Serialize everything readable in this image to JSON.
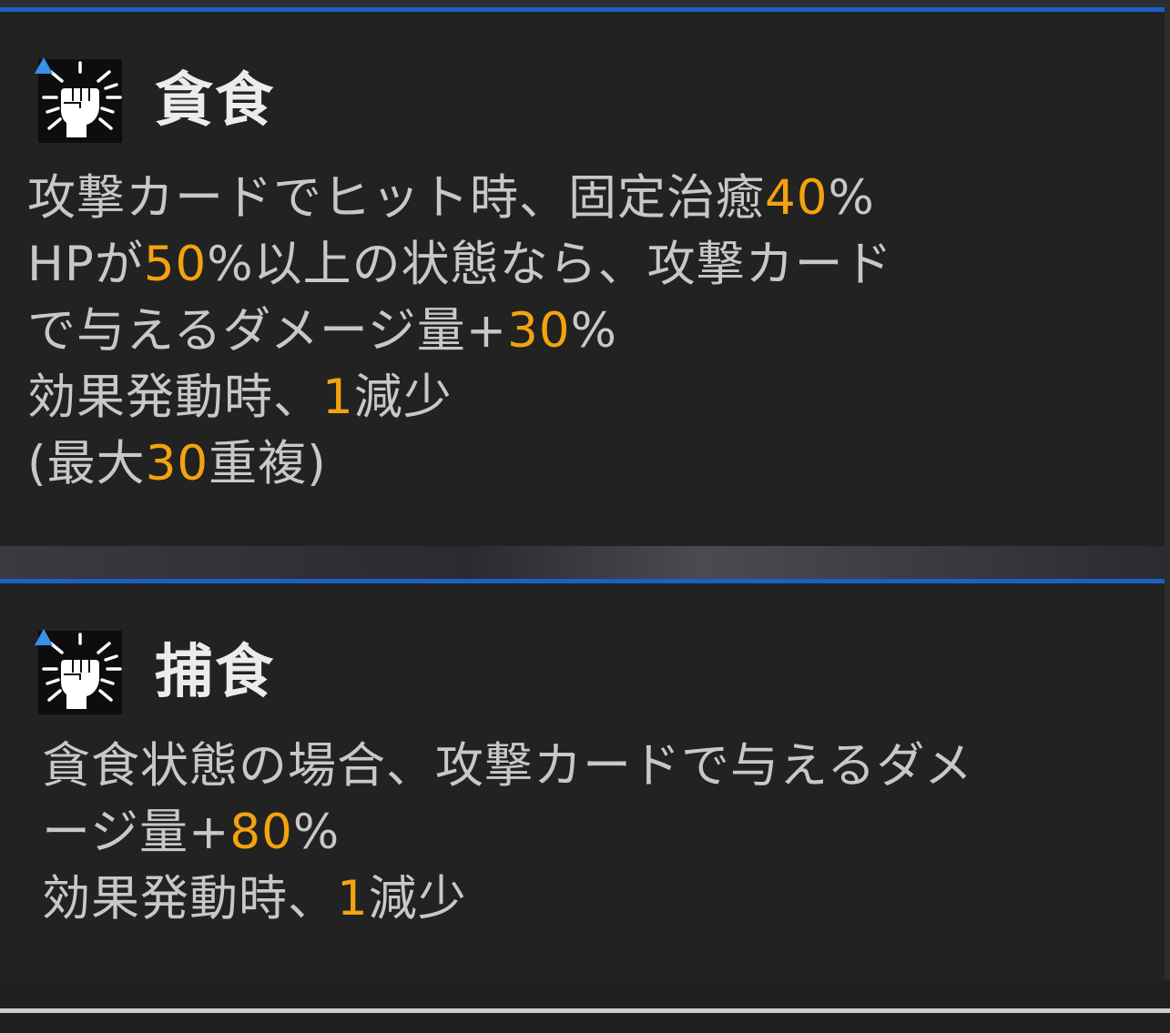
{
  "colors": {
    "accent_bar": "#1d5fc4",
    "panel_bg": "#222222",
    "text": "#c8c8c8",
    "title": "#ececec",
    "highlight": "#f4a30e",
    "icon_marker": "#3a8fe8"
  },
  "skills": [
    {
      "icon": "clenched-fist-burst-icon",
      "title": "貪食",
      "lines": [
        [
          {
            "text": "攻撃カードでヒット時、固定治癒",
            "hl": false
          },
          {
            "text": "40",
            "hl": true
          },
          {
            "text": "%",
            "hl": false
          }
        ],
        [
          {
            "text": "HPが",
            "hl": false
          },
          {
            "text": "50",
            "hl": true
          },
          {
            "text": "%以上の状態なら、攻撃カード",
            "hl": false
          }
        ],
        [
          {
            "text": "で与えるダメージ量+",
            "hl": false
          },
          {
            "text": "30",
            "hl": true
          },
          {
            "text": "%",
            "hl": false
          }
        ],
        [
          {
            "text": "効果発動時、",
            "hl": false
          },
          {
            "text": "1",
            "hl": true
          },
          {
            "text": "減少",
            "hl": false
          }
        ],
        [
          {
            "text": "(最大",
            "hl": false
          },
          {
            "text": "30",
            "hl": true
          },
          {
            "text": "重複)",
            "hl": false
          }
        ]
      ]
    },
    {
      "icon": "clenched-fist-burst-icon",
      "title": "捕食",
      "lines": [
        [
          {
            "text": "貪食状態の場合、攻撃カードで与えるダメ",
            "hl": false
          }
        ],
        [
          {
            "text": "ージ量+",
            "hl": false
          },
          {
            "text": "80",
            "hl": true
          },
          {
            "text": "%",
            "hl": false
          }
        ],
        [
          {
            "text": "効果発動時、",
            "hl": false
          },
          {
            "text": "1",
            "hl": true
          },
          {
            "text": "減少",
            "hl": false
          }
        ]
      ]
    }
  ]
}
